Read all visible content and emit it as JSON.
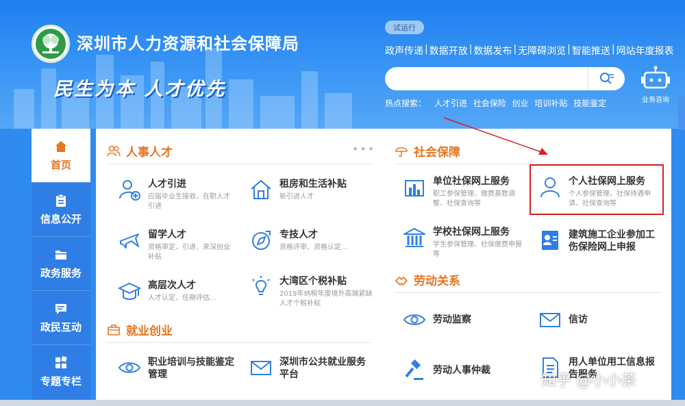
{
  "header": {
    "site_title": "深圳市人力资源和社会保障局",
    "slogan": "民生为本 人才优先",
    "trial_badge": "试运行",
    "top_links": [
      "政声传递",
      "数据开放",
      "数据发布",
      "无障碍浏览",
      "智能推送",
      "网站年度报表"
    ],
    "search_placeholder": "",
    "hot_search_label": "热点搜索：",
    "hot_search": [
      "人才引进",
      "社会保险",
      "创业",
      "培训补贴",
      "技能鉴定"
    ],
    "robot_label": "业务咨询"
  },
  "nav": {
    "items": [
      {
        "label": "首页",
        "icon": "home-icon",
        "active": true
      },
      {
        "label": "信息公开",
        "icon": "clipboard-icon",
        "active": false
      },
      {
        "label": "政务服务",
        "icon": "folder-icon",
        "active": false
      },
      {
        "label": "政民互动",
        "icon": "chat-icon",
        "active": false
      },
      {
        "label": "专题专栏",
        "icon": "grid-icon",
        "active": false
      }
    ]
  },
  "sections": {
    "talent": {
      "title": "人事人才",
      "items": [
        {
          "title": "人才引进",
          "desc": "应届毕业生接收、在职人才引进",
          "icon": "user-add-icon"
        },
        {
          "title": "租房和生活补贴",
          "desc": "新引进人才",
          "icon": "house-icon"
        },
        {
          "title": "留学人才",
          "desc": "资格审定、引进、来深创业补贴",
          "icon": "airplane-icon"
        },
        {
          "title": "专技人才",
          "desc": "资格评审、资格认定...",
          "icon": "compass-icon"
        },
        {
          "title": "高层次人才",
          "desc": "人才认定、任期评估...",
          "icon": "graduation-cap-icon"
        },
        {
          "title": "大湾区个税补贴",
          "desc": "2019年纳税年度境外高端紧缺人才个税补贴",
          "icon": "lightbulb-icon"
        }
      ]
    },
    "employment": {
      "title": "就业创业",
      "items": [
        {
          "title": "职业培训与技能鉴定管理",
          "desc": "",
          "icon": "eye-icon"
        },
        {
          "title": "深圳市公共就业服务平台",
          "desc": "",
          "icon": "envelope-icon"
        }
      ]
    },
    "social_security": {
      "title": "社会保障",
      "items": [
        {
          "title": "单位社保网上服务",
          "desc": "职工参保管理、缴费基数调整、社保查询等",
          "icon": "building-chart-icon"
        },
        {
          "title": "个人社保网上服务",
          "desc": "个人参保管理、社保待遇申请、社保查询等",
          "icon": "person-icon"
        },
        {
          "title": "学校社保网上服务",
          "desc": "学生参保管理、社保缴费申报等",
          "icon": "school-icon"
        },
        {
          "title": "建筑施工企业参加工伤保险网上申报",
          "desc": "",
          "icon": "id-card-icon"
        }
      ]
    },
    "labor": {
      "title": "劳动关系",
      "items": [
        {
          "title": "劳动监察",
          "desc": "",
          "icon": "eye-icon"
        },
        {
          "title": "信访",
          "desc": "",
          "icon": "envelope-icon"
        },
        {
          "title": "劳动人事仲裁",
          "desc": "",
          "icon": "gavel-icon"
        },
        {
          "title": "用人单位用工信息报告服务",
          "desc": "",
          "icon": "document-icon"
        }
      ]
    }
  },
  "watermark": "知乎 @小小茶",
  "colors": {
    "accent": "#e8751f",
    "nav_blue": "#2f7ee6",
    "highlight": "#d81e1e",
    "icon_blue": "#2f7ee6"
  }
}
